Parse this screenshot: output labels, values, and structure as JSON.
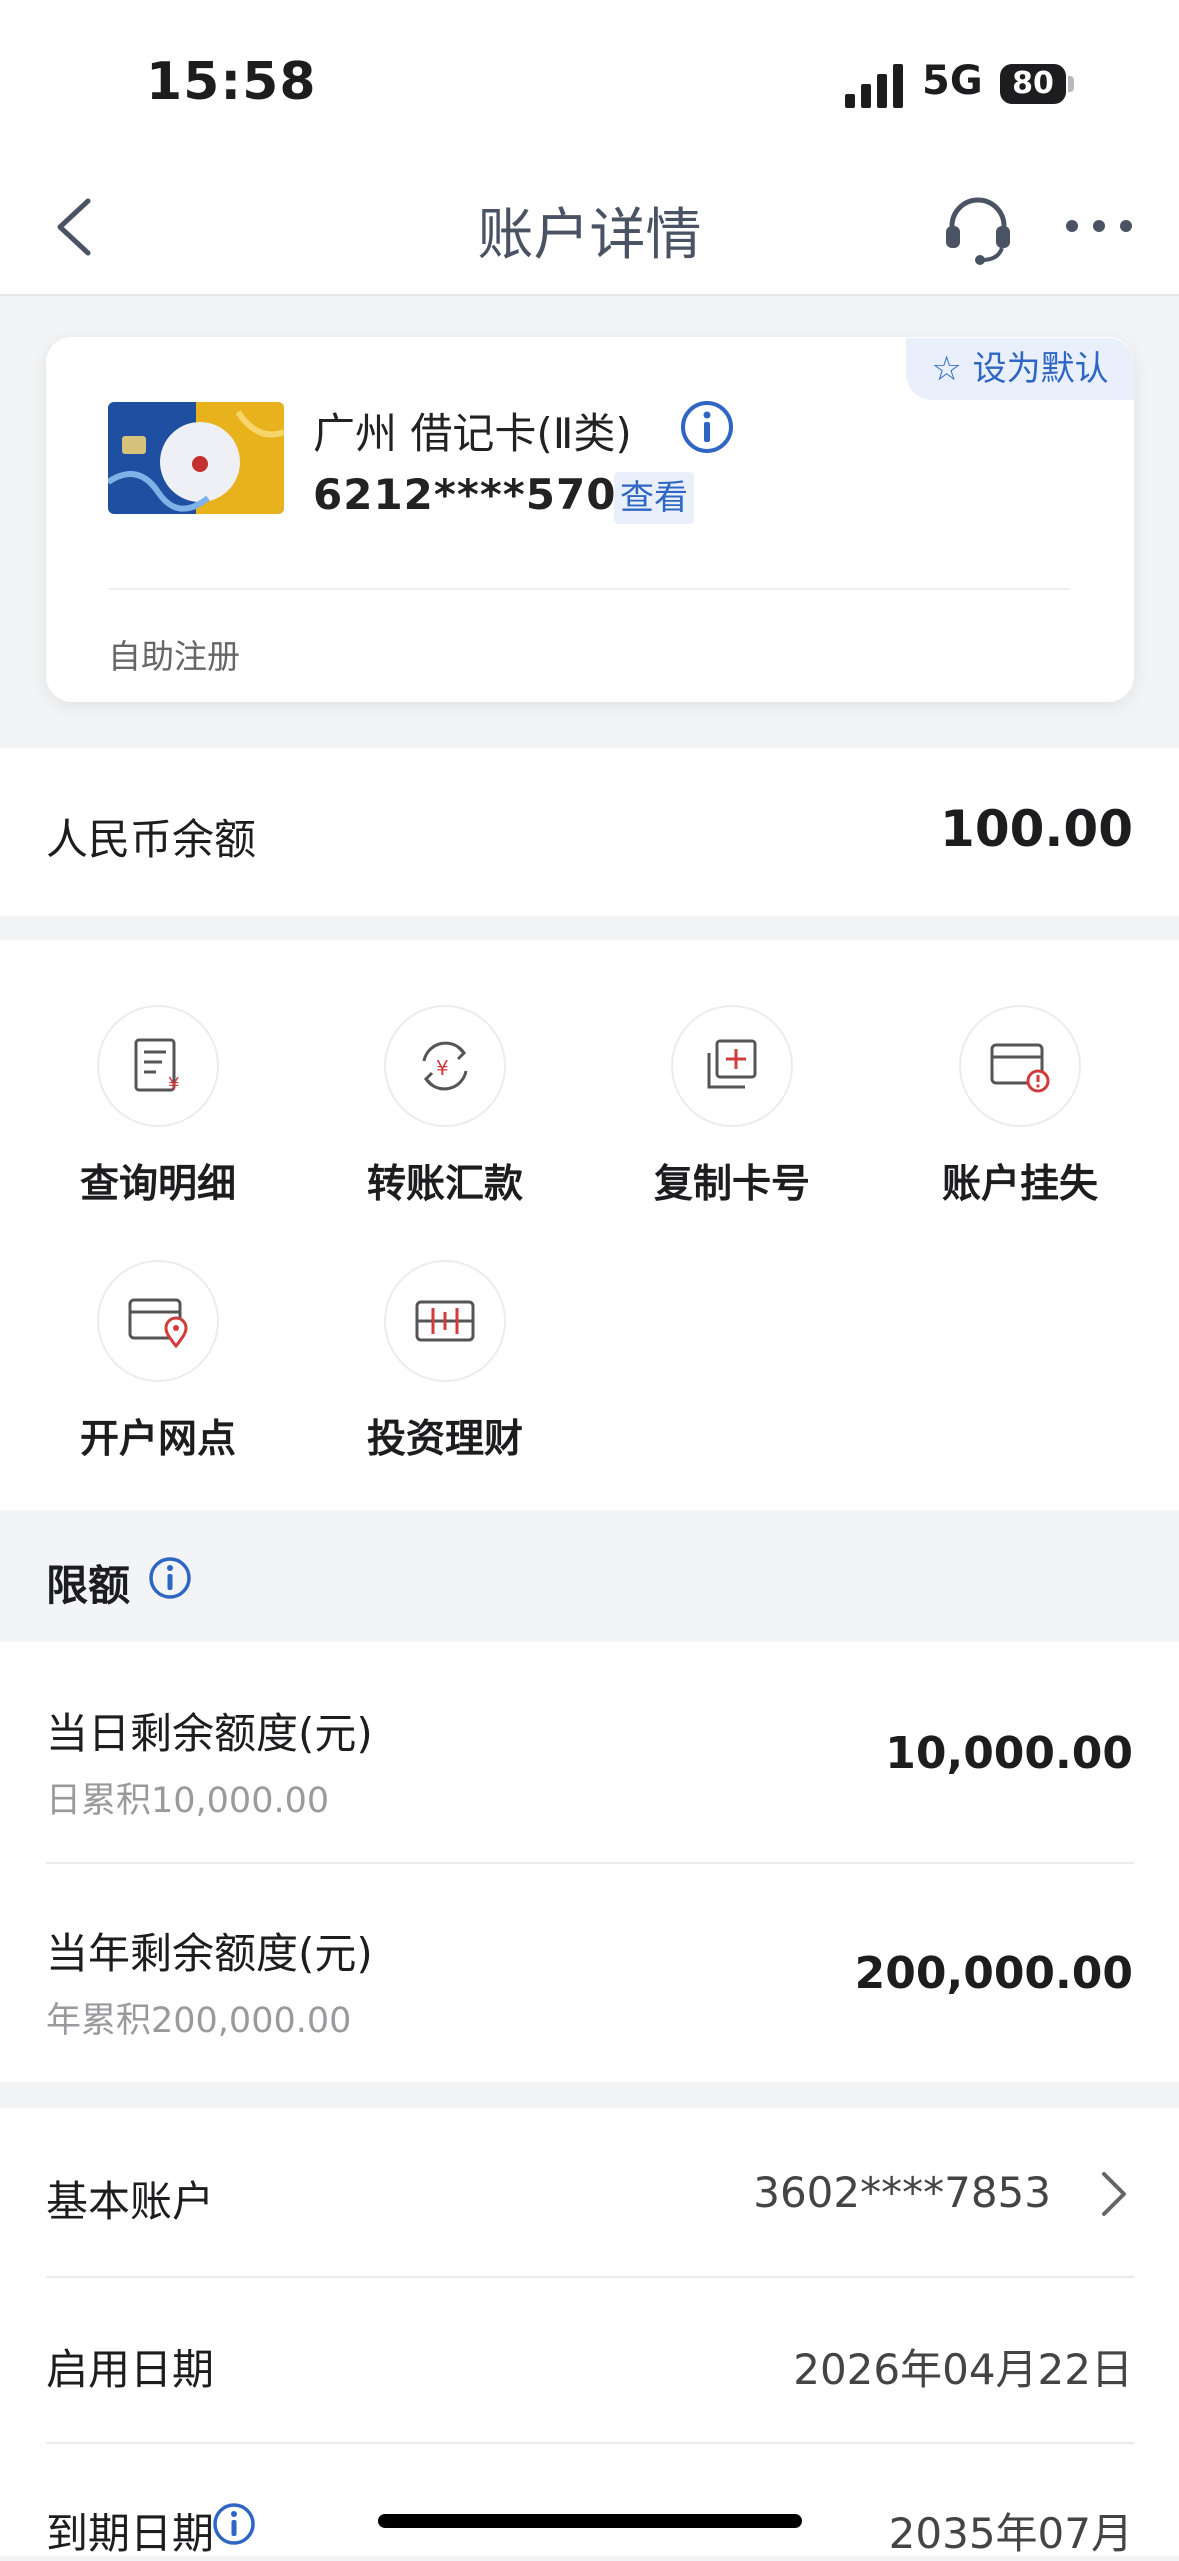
{
  "status": {
    "time": "15:58",
    "network": "5G",
    "battery": "80"
  },
  "nav": {
    "title": "账户详情"
  },
  "card": {
    "default_label": "设为默认",
    "name": "广州 借记卡(Ⅱ类)",
    "number": "6212****5708",
    "view_label": "查看",
    "note": "自助注册"
  },
  "balance": {
    "label": "人民币余额",
    "value": "100.00"
  },
  "actions": [
    {
      "label": "查询明细",
      "icon": "statement-icon"
    },
    {
      "label": "转账汇款",
      "icon": "transfer-icon"
    },
    {
      "label": "复制卡号",
      "icon": "copy-card-icon"
    },
    {
      "label": "账户挂失",
      "icon": "report-loss-icon"
    },
    {
      "label": "开户网点",
      "icon": "branch-location-icon"
    },
    {
      "label": "投资理财",
      "icon": "investment-icon"
    }
  ],
  "limits": {
    "title": "限额",
    "items": [
      {
        "label": "当日剩余额度(元)",
        "sub": "日累积10,000.00",
        "value": "10,000.00"
      },
      {
        "label": "当年剩余额度(元)",
        "sub": "年累积200,000.00",
        "value": "200,000.00"
      }
    ]
  },
  "info": [
    {
      "label": "基本账户",
      "value": "3602****7853"
    },
    {
      "label": "启用日期",
      "value": "2026年04月22日"
    },
    {
      "label": "到期日期",
      "value": "2035年07月"
    }
  ],
  "colors": {
    "accent": "#2f66c3",
    "icon_red": "#d23b3b"
  }
}
